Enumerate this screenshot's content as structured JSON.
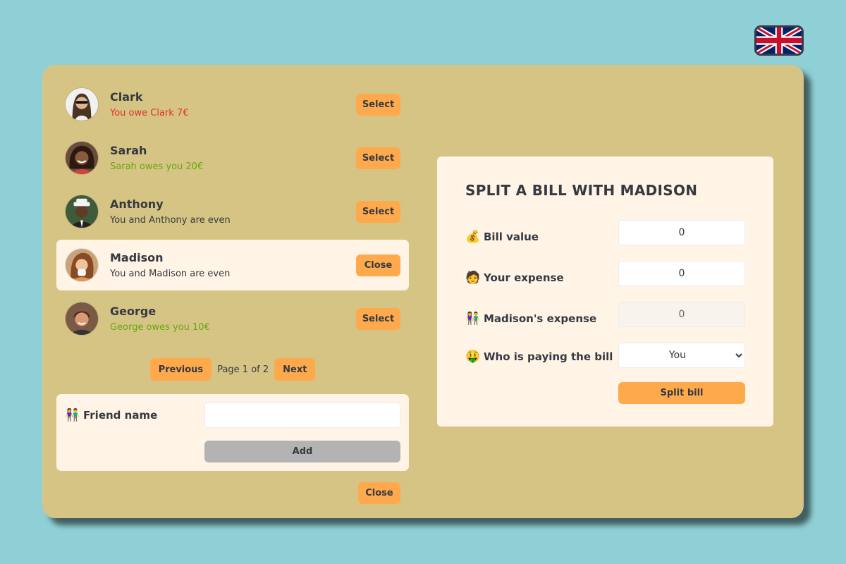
{
  "language": {
    "flag_icon": "uk-flag-icon"
  },
  "friends": [
    {
      "name": "Clark",
      "status": "You owe Clark 7€",
      "status_type": "negative",
      "button": "Select"
    },
    {
      "name": "Sarah",
      "status": "Sarah owes you 20€",
      "status_type": "positive",
      "button": "Select"
    },
    {
      "name": "Anthony",
      "status": "You and Anthony are even",
      "status_type": "even",
      "button": "Select"
    },
    {
      "name": "Madison",
      "status": "You and Madison are even",
      "status_type": "even",
      "button": "Close",
      "selected": true
    },
    {
      "name": "George",
      "status": "George owes you 10€",
      "status_type": "positive",
      "button": "Select"
    }
  ],
  "pagination": {
    "previous": "Previous",
    "info": "Page 1 of 2",
    "next": "Next"
  },
  "add_friend": {
    "label": "Friend name",
    "icon": "people-icon",
    "value": "",
    "button": "Add"
  },
  "close_button": "Close",
  "split": {
    "title": "SPLIT A BILL WITH MADISON",
    "bill_label": "Bill value",
    "bill_icon": "money-bag-icon",
    "bill_value": "0",
    "expense_label": "Your expense",
    "expense_icon": "person-icon",
    "expense_value": "0",
    "friend_expense_label": "Madison's expense",
    "friend_expense_icon": "people-icon",
    "friend_expense_value": "0",
    "payer_label": "Who is paying the bill",
    "payer_icon": "money-face-icon",
    "payer_value": "You",
    "button": "Split bill"
  },
  "colors": {
    "background": "#8fd0d6",
    "card": "#d6c485",
    "panel": "#fff4e6",
    "accent": "#ffa94d",
    "negative": "#e03131",
    "positive": "#66a80f"
  }
}
